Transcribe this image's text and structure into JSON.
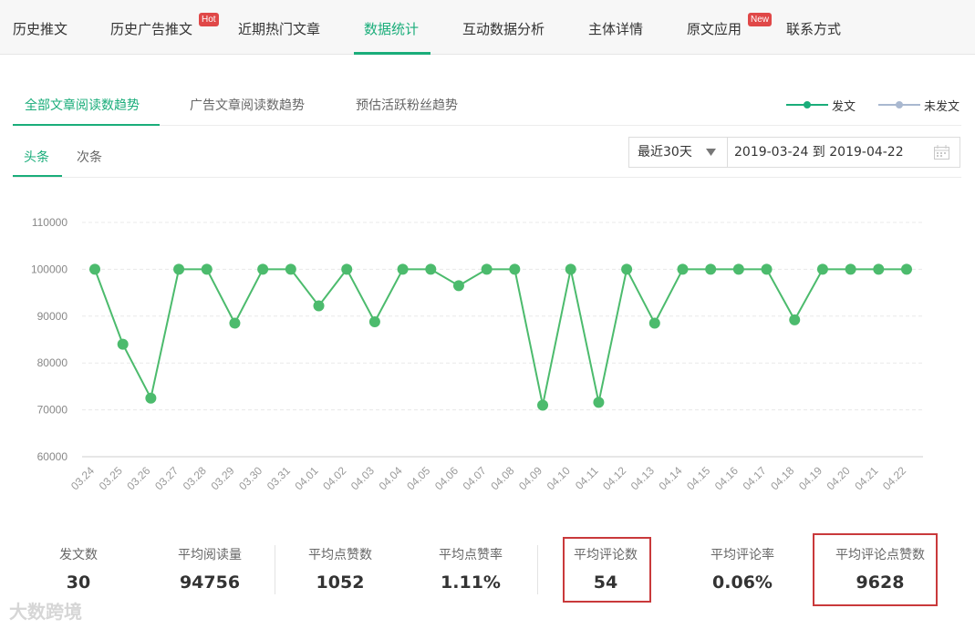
{
  "top_nav": {
    "tabs": [
      {
        "label": "历史推文"
      },
      {
        "label": "历史广告推文",
        "badge": "Hot"
      },
      {
        "label": "近期热门文章"
      },
      {
        "label": "数据统计",
        "active": true
      },
      {
        "label": "互动数据分析"
      },
      {
        "label": "主体详情"
      },
      {
        "label": "原文应用",
        "badge": "New"
      },
      {
        "label": "联系方式"
      }
    ]
  },
  "sub_tabs": [
    {
      "label": "全部文章阅读数趋势",
      "active": true
    },
    {
      "label": "广告文章阅读数趋势"
    },
    {
      "label": "预估活跃粉丝趋势"
    }
  ],
  "legend": [
    {
      "label": "发文",
      "color": "#1aad7a"
    },
    {
      "label": "未发文",
      "color": "#a9b8d0"
    }
  ],
  "position_tabs": [
    {
      "label": "头条",
      "active": true
    },
    {
      "label": "次条"
    }
  ],
  "date_picker": {
    "preset": "最近30天",
    "range": "2019-03-24 到 2019-04-22",
    "calendar_icon": "calendar-icon"
  },
  "chart_data": {
    "type": "line",
    "categories": [
      "03.24",
      "03.25",
      "03.26",
      "03.27",
      "03.28",
      "03.29",
      "03.30",
      "03.31",
      "04.01",
      "04.02",
      "04.03",
      "04.04",
      "04.05",
      "04.06",
      "04.07",
      "04.08",
      "04.09",
      "04.10",
      "04.11",
      "04.12",
      "04.13",
      "04.14",
      "04.15",
      "04.16",
      "04.17",
      "04.18",
      "04.19",
      "04.20",
      "04.21",
      "04.22"
    ],
    "series": [
      {
        "name": "发文",
        "color": "#4cbb6d",
        "values": [
          100001,
          84000,
          72500,
          100001,
          100001,
          88500,
          100001,
          100001,
          92200,
          100001,
          88800,
          100001,
          100001,
          96500,
          100001,
          100001,
          71000,
          100001,
          71600,
          100001,
          88500,
          100001,
          100001,
          100001,
          100001,
          89200,
          100001,
          100001,
          100001,
          100001
        ]
      }
    ],
    "ylim": [
      60000,
      110000
    ],
    "yticks": [
      110000,
      100000,
      90000,
      80000,
      70000,
      60000
    ],
    "grid": true
  },
  "stats": [
    {
      "label": "发文数",
      "value": "30"
    },
    {
      "label": "平均阅读量",
      "value": "94756"
    },
    {
      "label": "平均点赞数",
      "value": "1052"
    },
    {
      "label": "平均点赞率",
      "value": "1.11%"
    },
    {
      "label": "平均评论数",
      "value": "54"
    },
    {
      "label": "平均评论率",
      "value": "0.06%"
    },
    {
      "label": "平均评论点赞数",
      "value": "9628"
    }
  ],
  "watermark": "大数跨境"
}
